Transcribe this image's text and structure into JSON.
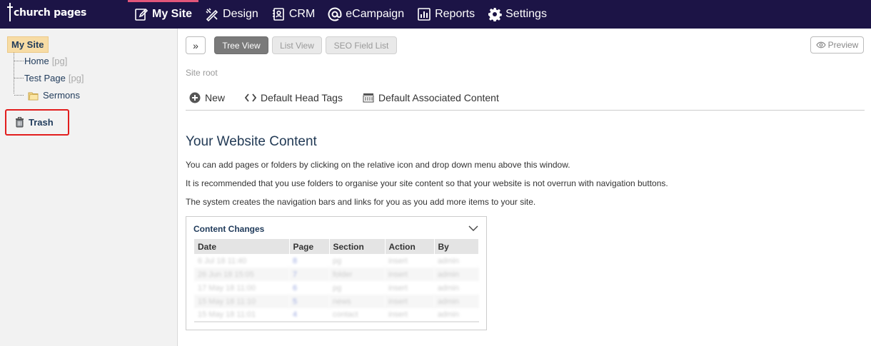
{
  "brand": {
    "name": "church pages"
  },
  "nav": [
    {
      "label": "My Site",
      "icon": "edit-icon",
      "active": true
    },
    {
      "label": "Design",
      "icon": "design-icon",
      "active": false
    },
    {
      "label": "CRM",
      "icon": "crm-icon",
      "active": false
    },
    {
      "label": "eCampaign",
      "icon": "at-icon",
      "active": false
    },
    {
      "label": "Reports",
      "icon": "reports-icon",
      "active": false
    },
    {
      "label": "Settings",
      "icon": "gear-icon",
      "active": false
    }
  ],
  "colors": {
    "topbar": "#1c1446",
    "nav_active": "#e2567a",
    "highlight": "#f7dca5",
    "trash_outline": "#e21d1d"
  },
  "sidebar": {
    "root_label": "My Site",
    "items": [
      {
        "label": "Home",
        "tag": "[pg]"
      },
      {
        "label": "Test Page",
        "tag": "[pg]"
      },
      {
        "label": "Sermons",
        "icon": "folder-icon"
      }
    ],
    "trash_label": "Trash"
  },
  "toolbar": {
    "tree_view": "Tree View",
    "list_view": "List View",
    "seo_field_list": "SEO Field List",
    "preview": "Preview"
  },
  "site_root_label": "Site root",
  "actions": {
    "new": "New",
    "default_head_tags": "Default Head Tags",
    "default_associated_content": "Default Associated Content"
  },
  "content": {
    "title": "Your Website Content",
    "paragraphs": [
      "You can add pages or folders by clicking on the relative icon and drop down menu above this window.",
      "It is recommended that you use folders to organise your site content so that your website is not overrun with navigation buttons.",
      "The system creates the navigation bars and links for you as you add more items to your site."
    ]
  },
  "changes": {
    "title": "Content Changes",
    "columns": [
      "Date",
      "Page",
      "Section",
      "Action",
      "By"
    ],
    "rows": [
      [
        "6 Jul 18 11:40",
        "8",
        "pg",
        "insert",
        "admin"
      ],
      [
        "26 Jun 18 15:05",
        "7",
        "folder",
        "insert",
        "admin"
      ],
      [
        "17 May 18 11:00",
        "6",
        "pg",
        "insert",
        "admin"
      ],
      [
        "15 May 18 11:10",
        "5",
        "news",
        "insert",
        "admin"
      ],
      [
        "15 May 18 11:01",
        "4",
        "contact",
        "insert",
        "admin"
      ]
    ]
  }
}
